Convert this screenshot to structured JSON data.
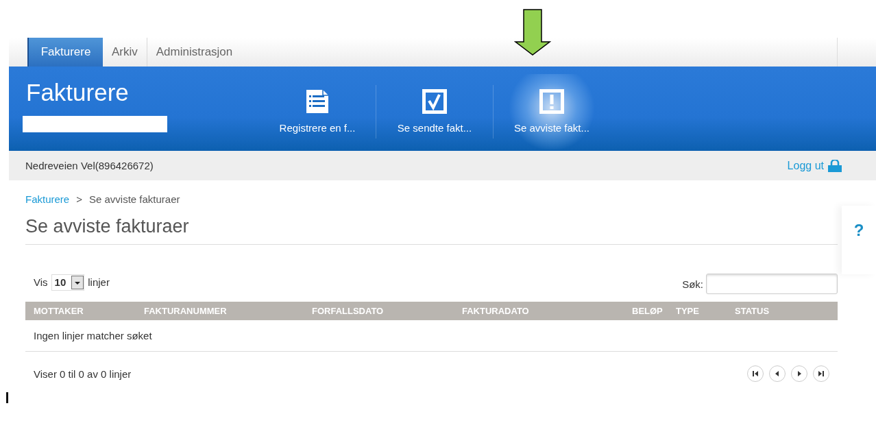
{
  "top_nav": [
    {
      "label": "Fakturere",
      "selected": true
    },
    {
      "label": "Arkiv",
      "selected": false
    },
    {
      "label": "Administrasjon",
      "selected": false
    }
  ],
  "header": {
    "title": "Fakturere",
    "actions": [
      {
        "label": "Registrere en f...",
        "kind": "list",
        "selected": false
      },
      {
        "label": "Se sendte fakt...",
        "kind": "check",
        "selected": false
      },
      {
        "label": "Se avviste fakt...",
        "kind": "alert",
        "selected": true
      }
    ]
  },
  "user_bar": {
    "user": "Nedreveien Vel(896426672)",
    "logout": "Logg ut"
  },
  "breadcrumb": [
    {
      "label": "Fakturere",
      "link": true
    },
    {
      "label": ">",
      "link": false
    },
    {
      "label": "Se avviste fakturaer",
      "link": false
    }
  ],
  "page_title": "Se avviste fakturaer",
  "help": "?",
  "length_control": {
    "before": "Vis",
    "value": "10",
    "after": "linjer"
  },
  "search": {
    "label": "Søk:"
  },
  "table": {
    "columns": [
      "MOTTAKER",
      "FAKTURANUMMER",
      "FORFALLSDATO",
      "FAKTURADATO",
      "BELØP",
      "TYPE",
      "STATUS"
    ],
    "empty_message": "Ingen linjer matcher søket"
  },
  "footer": {
    "info": "Viser 0 til 0 av 0 linjer"
  }
}
